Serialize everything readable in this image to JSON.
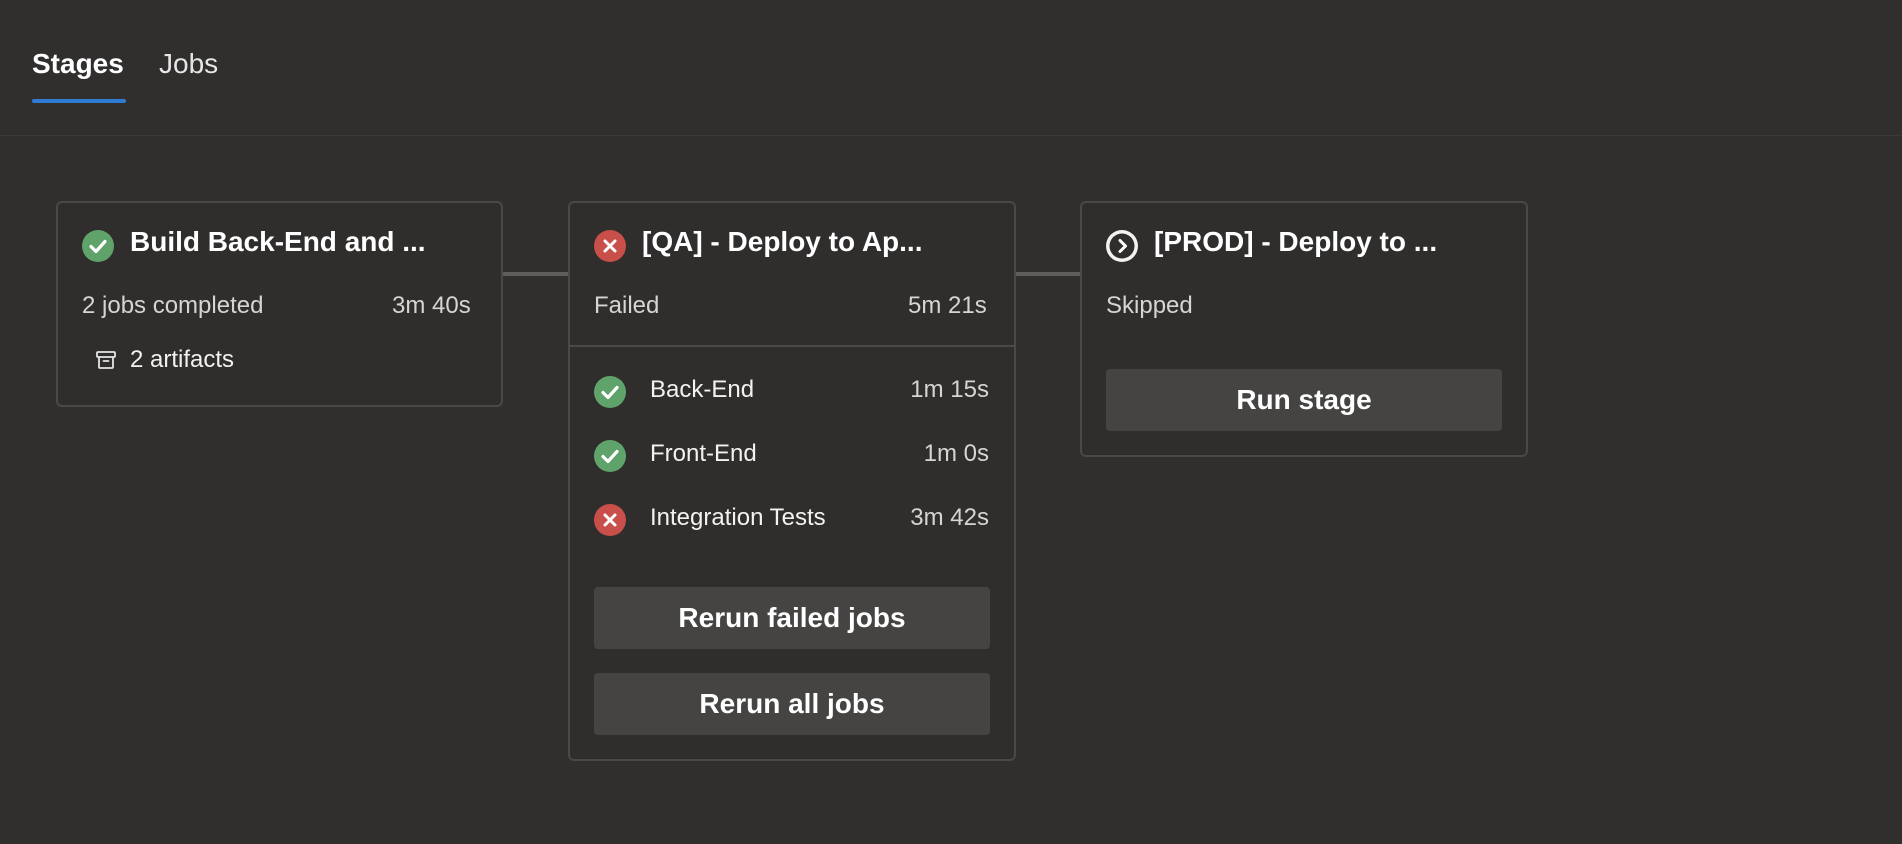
{
  "tabs": [
    {
      "label": "Stages",
      "active": true
    },
    {
      "label": "Jobs",
      "active": false
    }
  ],
  "stages": [
    {
      "title": "Build Back-End and ...",
      "status": "succeeded",
      "summary": "2 jobs completed",
      "duration": "3m 40s",
      "artifacts": "2 artifacts"
    },
    {
      "title": "[QA] - Deploy to Ap...",
      "status": "failed",
      "summary": "Failed",
      "duration": "5m 21s",
      "jobs": [
        {
          "name": "Back-End",
          "duration": "1m 15s",
          "status": "succeeded"
        },
        {
          "name": "Front-End",
          "duration": "1m 0s",
          "status": "succeeded"
        },
        {
          "name": "Integration Tests",
          "duration": "3m 42s",
          "status": "failed"
        }
      ],
      "buttons": {
        "rerun_failed": "Rerun failed jobs",
        "rerun_all": "Rerun all jobs"
      }
    },
    {
      "title": "[PROD] - Deploy to ...",
      "status": "skipped",
      "summary": "Skipped",
      "button": "Run stage"
    }
  ],
  "colors": {
    "success": "#5fa36a",
    "failure": "#c9504a",
    "accent": "#2f7bd4"
  }
}
